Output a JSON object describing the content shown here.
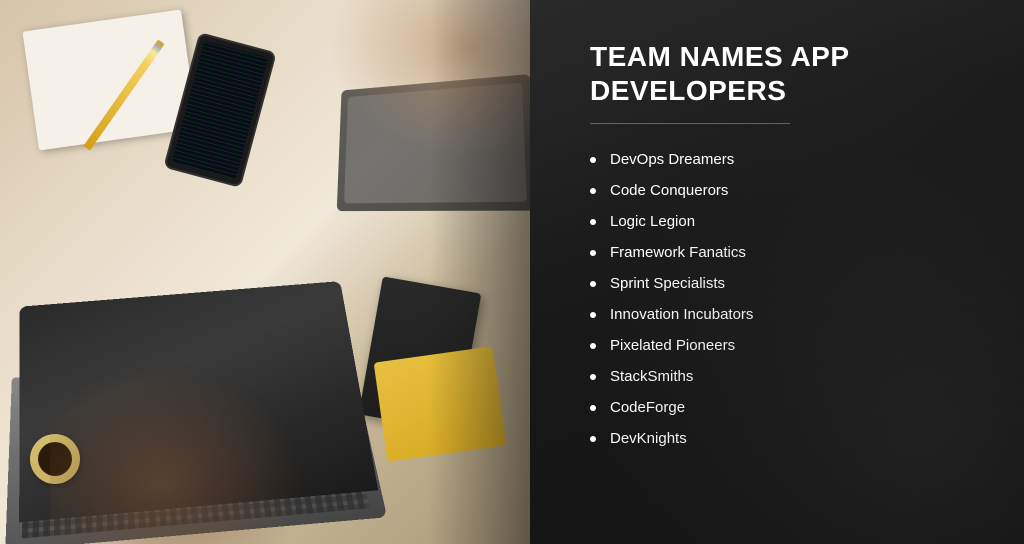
{
  "header": {
    "title_line1": "TEAM NAMES APP",
    "title_line2": "DEVELOPERS"
  },
  "teamList": {
    "items": [
      {
        "id": 1,
        "name": "DevOps Dreamers"
      },
      {
        "id": 2,
        "name": "Code Conquerors"
      },
      {
        "id": 3,
        "name": "Logic Legion"
      },
      {
        "id": 4,
        "name": "Framework Fanatics"
      },
      {
        "id": 5,
        "name": "Sprint Specialists"
      },
      {
        "id": 6,
        "name": "Innovation Incubators"
      },
      {
        "id": 7,
        "name": "Pixelated Pioneers"
      },
      {
        "id": 8,
        "name": "StackSmiths"
      },
      {
        "id": 9,
        "name": "CodeForge"
      },
      {
        "id": 10,
        "name": "DevKnights"
      }
    ]
  }
}
